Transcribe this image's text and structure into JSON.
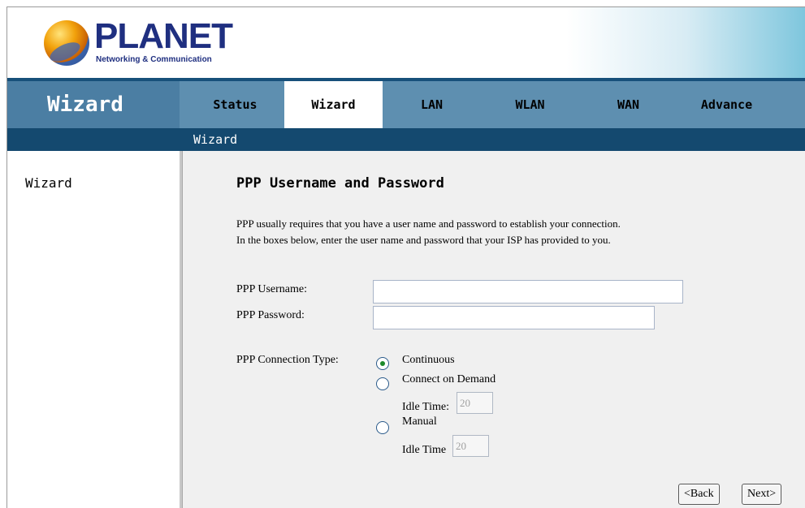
{
  "header": {
    "logo_text": "PLANET",
    "logo_subtitle": "Networking & Communication"
  },
  "nav": {
    "section_title": "Wizard",
    "tabs": [
      {
        "label": "Status"
      },
      {
        "label": "Wizard"
      },
      {
        "label": "LAN"
      },
      {
        "label": "WLAN"
      },
      {
        "label": "WAN"
      },
      {
        "label": "Advance"
      }
    ],
    "active_tab": "Wizard",
    "subnav_item": "Wizard"
  },
  "sidebar": {
    "item": "Wizard"
  },
  "main": {
    "title": "PPP Username and Password",
    "description_line1": "PPP usually requires that you have a user name and password to establish your connection.",
    "description_line2": "In the boxes below, enter the user name and password that your ISP has provided to you.",
    "username_label": "PPP Username:",
    "username_value": "",
    "password_label": "PPP Password:",
    "password_value": "",
    "connection_type_label": "PPP Connection Type:",
    "options": [
      {
        "label": "Continuous",
        "checked": true
      },
      {
        "label": "Connect on Demand",
        "checked": false
      },
      {
        "label": "Manual",
        "checked": false
      }
    ],
    "idle_time_label_1": "Idle Time:",
    "idle_time_value_1": "20",
    "idle_time_label_2": "Idle Time",
    "idle_time_value_2": "20",
    "back_button": "<Back",
    "next_button": "Next>"
  },
  "colors": {
    "nav_bg": "#5e8fb0",
    "nav_title_bg": "#4b7ea3",
    "subnav_bg": "#14496f",
    "content_bg": "#f0f0f0",
    "logo_blue": "#1f2f80"
  }
}
